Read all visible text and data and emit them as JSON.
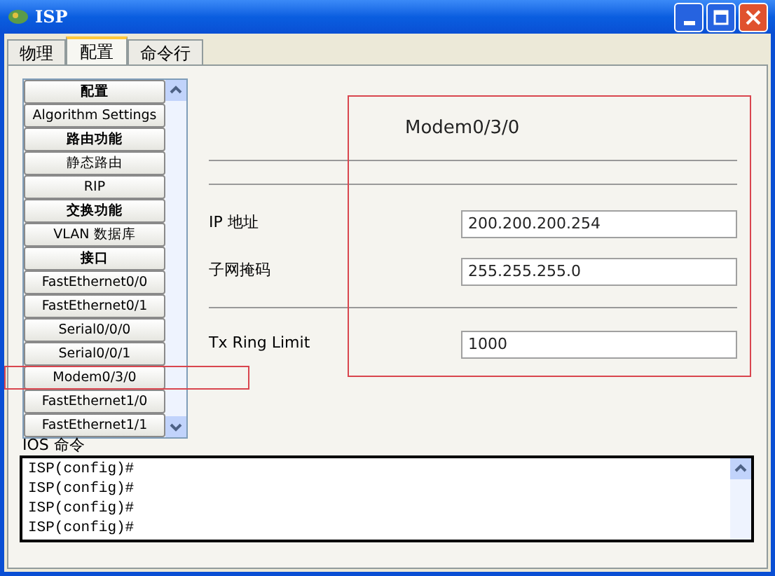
{
  "window": {
    "title": "ISP"
  },
  "tabs": [
    {
      "label": "物理",
      "selected": false
    },
    {
      "label": "配置",
      "selected": true
    },
    {
      "label": "命令行",
      "selected": false
    }
  ],
  "sidebar": {
    "items": [
      {
        "label": "配置",
        "kind": "header"
      },
      {
        "label": "Algorithm Settings",
        "kind": "item"
      },
      {
        "label": "路由功能",
        "kind": "header"
      },
      {
        "label": "静态路由",
        "kind": "item"
      },
      {
        "label": "RIP",
        "kind": "item"
      },
      {
        "label": "交换功能",
        "kind": "header"
      },
      {
        "label": "VLAN 数据库",
        "kind": "item"
      },
      {
        "label": "接口",
        "kind": "header"
      },
      {
        "label": "FastEthernet0/0",
        "kind": "item"
      },
      {
        "label": "FastEthernet0/1",
        "kind": "item"
      },
      {
        "label": "Serial0/0/0",
        "kind": "item"
      },
      {
        "label": "Serial0/0/1",
        "kind": "item"
      },
      {
        "label": "Modem0/3/0",
        "kind": "item"
      },
      {
        "label": "FastEthernet1/0",
        "kind": "item"
      },
      {
        "label": "FastEthernet1/1",
        "kind": "item"
      }
    ]
  },
  "panel": {
    "title": "Modem0/3/0",
    "fields": [
      {
        "label": "IP 地址",
        "value": "200.200.200.254"
      },
      {
        "label": "子网掩码",
        "value": "255.255.255.0"
      },
      {
        "label": "Tx Ring Limit",
        "value": "1000"
      }
    ]
  },
  "console": {
    "label": "IOS 命令",
    "lines": [
      "ISP(config)#",
      "ISP(config)#",
      "ISP(config)#",
      "ISP(config)#"
    ]
  }
}
